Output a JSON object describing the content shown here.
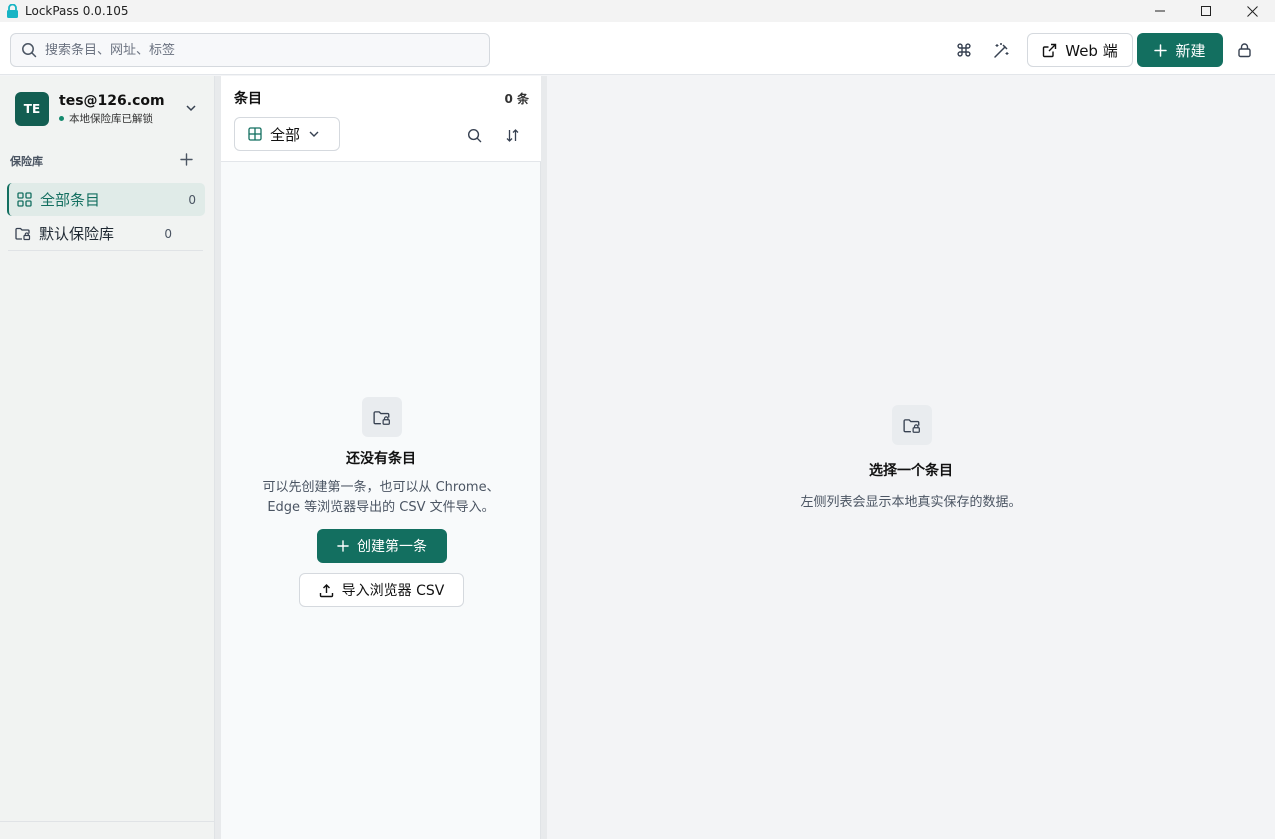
{
  "window": {
    "title": "LockPass 0.0.105",
    "controls": [
      "minimize",
      "maximize",
      "close"
    ]
  },
  "toolbar": {
    "search_placeholder": "搜索条目、网址、标签",
    "icons": [
      "command-icon",
      "magic-wand-icon"
    ],
    "web_label": "Web 端",
    "new_label": "新建",
    "lock_icon": "lock-icon"
  },
  "account": {
    "initials": "TE",
    "email": "tes@126.com",
    "status": "本地保险库已解锁"
  },
  "sidebar": {
    "section_title": "保险库",
    "items": [
      {
        "label": "全部条目",
        "count": "0",
        "icon": "grid-icon",
        "active": true
      },
      {
        "label": "默认保险库",
        "count": "0",
        "icon": "folder-lock-icon",
        "active": false
      }
    ]
  },
  "entries": {
    "title": "条目",
    "count": "0 条",
    "filter_label": "全部",
    "empty_title": "还没有条目",
    "empty_desc_line1": "可以先创建第一条，也可以从 Chrome、",
    "empty_desc_line2": "Edge 等浏览器导出的 CSV 文件导入。",
    "create_label": "创建第一条",
    "import_label": "导入浏览器 CSV"
  },
  "detail": {
    "empty_title": "选择一个条目",
    "empty_desc": "左侧列表会显示本地真实保存的数据。"
  },
  "colors": {
    "accent": "#136f60",
    "avatar": "#135e52"
  }
}
